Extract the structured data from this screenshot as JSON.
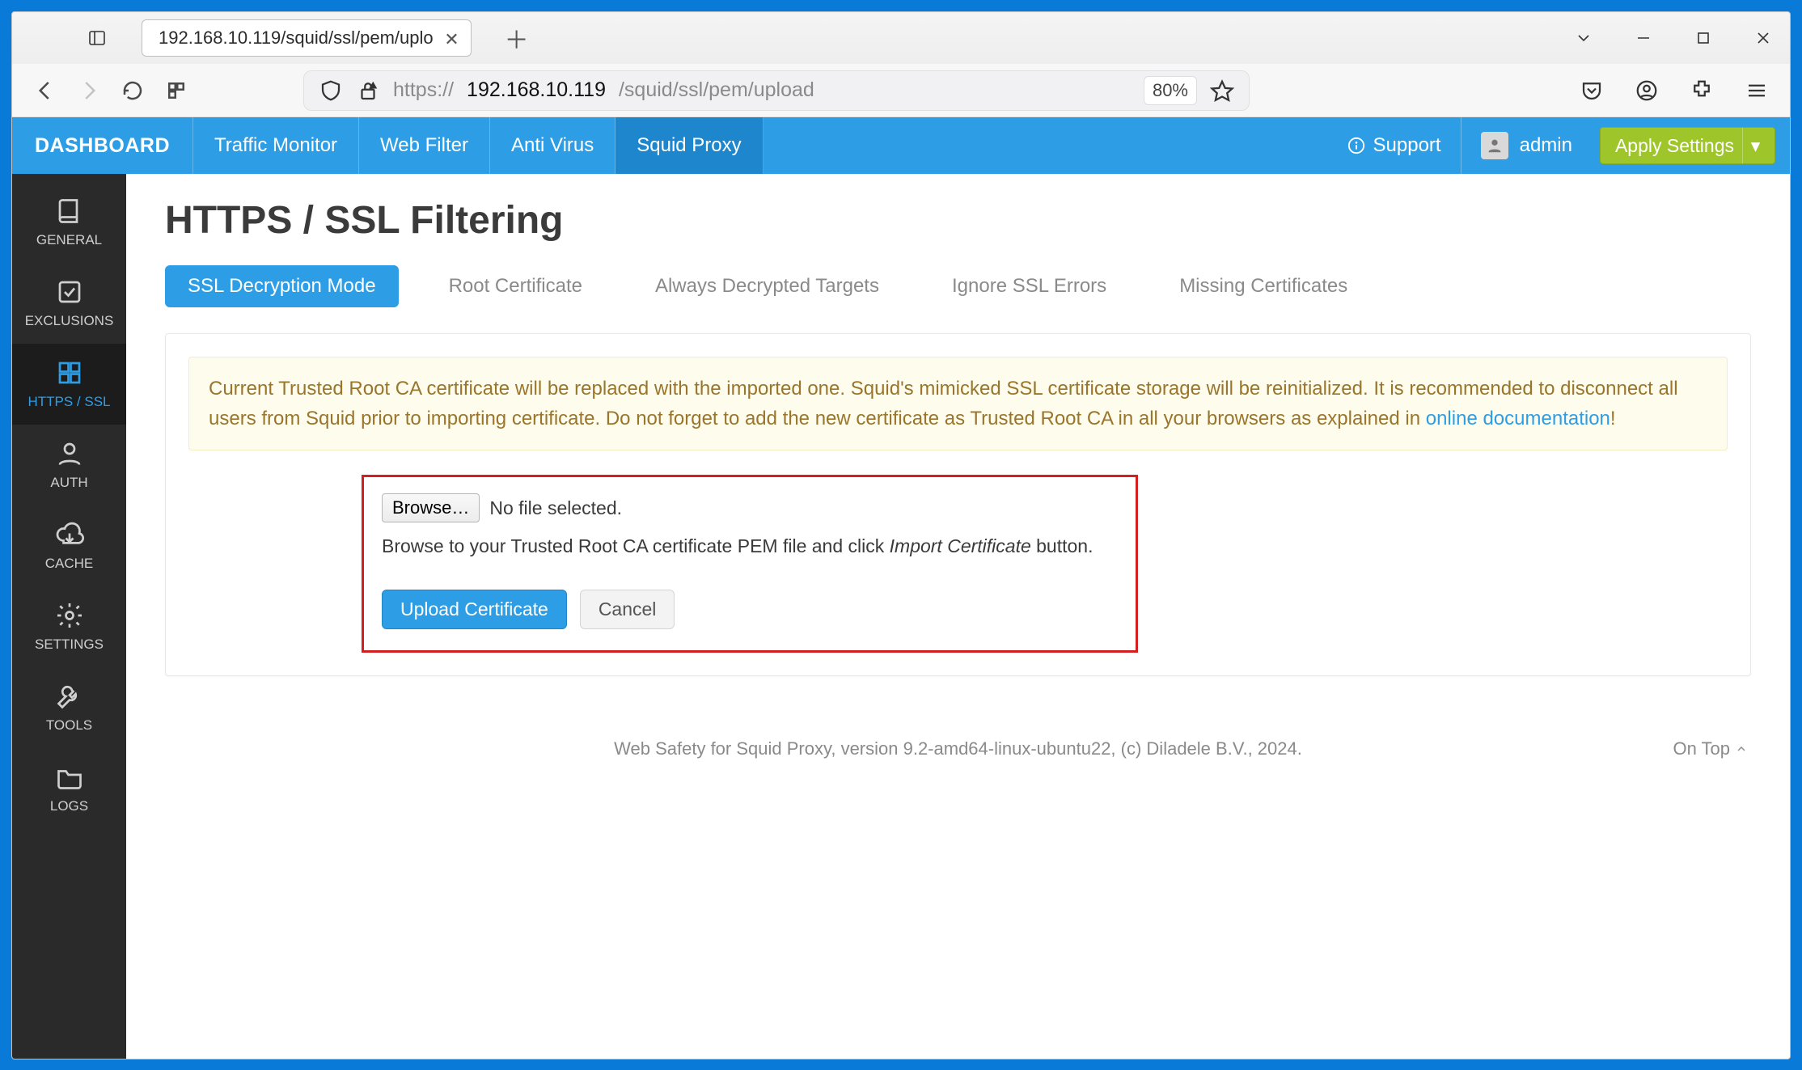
{
  "browser": {
    "tab_title": "192.168.10.119/squid/ssl/pem/uplo",
    "url_protocol": "https://",
    "url_host": "192.168.10.119",
    "url_path": "/squid/ssl/pem/upload",
    "zoom": "80%"
  },
  "appnav": {
    "brand": "DASHBOARD",
    "items": [
      "Traffic Monitor",
      "Web Filter",
      "Anti Virus",
      "Squid Proxy"
    ],
    "active_index": 3,
    "support": "Support",
    "user": "admin",
    "apply": "Apply Settings"
  },
  "sidebar": {
    "items": [
      {
        "label": "GENERAL"
      },
      {
        "label": "EXCLUSIONS"
      },
      {
        "label": "HTTPS / SSL"
      },
      {
        "label": "AUTH"
      },
      {
        "label": "CACHE"
      },
      {
        "label": "SETTINGS"
      },
      {
        "label": "TOOLS"
      },
      {
        "label": "LOGS"
      }
    ],
    "active_index": 2
  },
  "page": {
    "title": "HTTPS / SSL Filtering",
    "tabs": [
      "SSL Decryption Mode",
      "Root Certificate",
      "Always Decrypted Targets",
      "Ignore SSL Errors",
      "Missing Certificates"
    ],
    "active_tab": 0,
    "alert_text_before_link": "Current Trusted Root CA certificate will be replaced with the imported one. Squid's mimicked SSL certificate storage will be reinitialized. It is recommended to disconnect all users from Squid prior to importing certificate. Do not forget to add the new certificate as Trusted Root CA in all your browsers as explained in ",
    "alert_link": "online documentation",
    "alert_after_link": "!",
    "browse_label": "Browse…",
    "no_file": "No file selected.",
    "hint_before_em": "Browse to your Trusted Root CA certificate PEM file and click ",
    "hint_em": "Import Certificate",
    "hint_after_em": " button.",
    "upload_btn": "Upload Certificate",
    "cancel_btn": "Cancel",
    "footer": "Web Safety for Squid Proxy, version 9.2-amd64-linux-ubuntu22, (c) Diladele B.V., 2024.",
    "ontop": "On Top"
  }
}
